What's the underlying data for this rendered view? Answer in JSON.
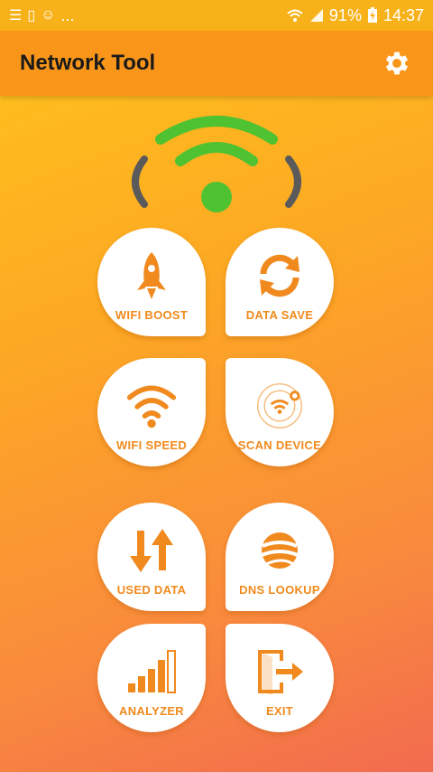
{
  "status_bar": {
    "left_icons": [
      "list-icon",
      "sim-icon",
      "face-icon"
    ],
    "ellipsis": "...",
    "battery": "91%",
    "time": "14:37"
  },
  "app_bar": {
    "title": "Network Tool",
    "settings_icon": "gear-icon"
  },
  "tiles": [
    {
      "label": "WIFI BOOST",
      "icon": "rocket-icon"
    },
    {
      "label": "DATA SAVE",
      "icon": "sync-icon"
    },
    {
      "label": "WIFI SPEED",
      "icon": "wifi-signal-icon"
    },
    {
      "label": "SCAN DEVICE",
      "icon": "radar-icon"
    },
    {
      "label": "USED DATA",
      "icon": "transfer-arrows-icon"
    },
    {
      "label": "DNS LOOKUP",
      "icon": "globe-icon"
    },
    {
      "label": "ANALYZER",
      "icon": "signal-bars-icon"
    },
    {
      "label": "EXIT",
      "icon": "exit-icon"
    }
  ],
  "colors": {
    "accent": "#f08a1e",
    "appbar": "#f9961a",
    "wifi_green": "#4fc232",
    "wifi_gray": "#5a5a5a"
  }
}
